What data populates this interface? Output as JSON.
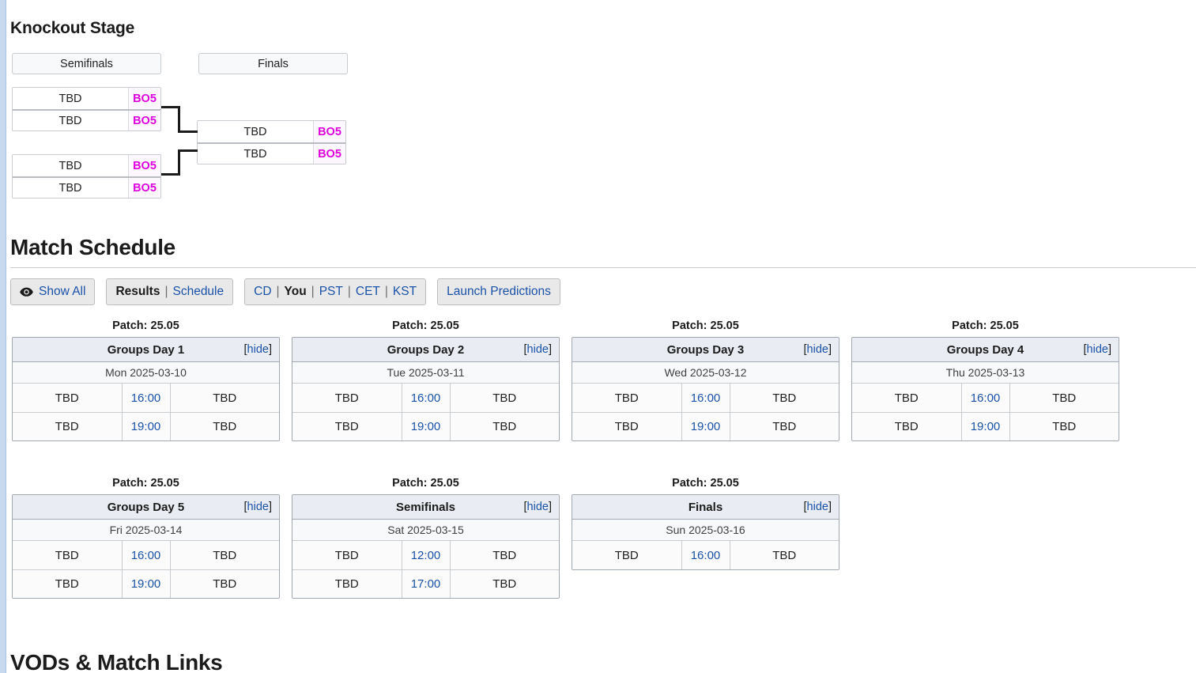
{
  "knockout": {
    "title": "Knockout Stage",
    "rounds": [
      {
        "label": "Semifinals"
      },
      {
        "label": "Finals"
      }
    ],
    "matches": [
      {
        "top_team": "TBD",
        "top_format": "BO5",
        "bottom_team": "TBD",
        "bottom_format": "BO5"
      },
      {
        "top_team": "TBD",
        "top_format": "BO5",
        "bottom_team": "TBD",
        "bottom_format": "BO5"
      },
      {
        "top_team": "TBD",
        "top_format": "BO5",
        "bottom_team": "TBD",
        "bottom_format": "BO5"
      }
    ]
  },
  "schedule": {
    "title": "Match Schedule",
    "toolbar": {
      "show_all": {
        "icon": "eye-icon",
        "label": "Show All"
      },
      "view": {
        "results": "Results",
        "separator": "|",
        "schedule": "Schedule"
      },
      "timezones": {
        "cd": "CD",
        "you": "You",
        "pst": "PST",
        "cet": "CET",
        "kst": "KST",
        "separator": "|"
      },
      "predictions": "Launch Predictions"
    },
    "cards": [
      {
        "patch": "Patch: 25.05",
        "title": "Groups Day 1",
        "hide": "hide",
        "date": "Mon 2025-03-10",
        "matches": [
          {
            "left": "TBD",
            "time": "16:00",
            "right": "TBD"
          },
          {
            "left": "TBD",
            "time": "19:00",
            "right": "TBD"
          }
        ]
      },
      {
        "patch": "Patch: 25.05",
        "title": "Groups Day 2",
        "hide": "hide",
        "date": "Tue 2025-03-11",
        "matches": [
          {
            "left": "TBD",
            "time": "16:00",
            "right": "TBD"
          },
          {
            "left": "TBD",
            "time": "19:00",
            "right": "TBD"
          }
        ]
      },
      {
        "patch": "Patch: 25.05",
        "title": "Groups Day 3",
        "hide": "hide",
        "date": "Wed 2025-03-12",
        "matches": [
          {
            "left": "TBD",
            "time": "16:00",
            "right": "TBD"
          },
          {
            "left": "TBD",
            "time": "19:00",
            "right": "TBD"
          }
        ]
      },
      {
        "patch": "Patch: 25.05",
        "title": "Groups Day 4",
        "hide": "hide",
        "date": "Thu 2025-03-13",
        "matches": [
          {
            "left": "TBD",
            "time": "16:00",
            "right": "TBD"
          },
          {
            "left": "TBD",
            "time": "19:00",
            "right": "TBD"
          }
        ]
      },
      {
        "patch": "Patch: 25.05",
        "title": "Groups Day 5",
        "hide": "hide",
        "date": "Fri 2025-03-14",
        "matches": [
          {
            "left": "TBD",
            "time": "16:00",
            "right": "TBD"
          },
          {
            "left": "TBD",
            "time": "19:00",
            "right": "TBD"
          }
        ]
      },
      {
        "patch": "Patch: 25.05",
        "title": "Semifinals",
        "hide": "hide",
        "date": "Sat 2025-03-15",
        "matches": [
          {
            "left": "TBD",
            "time": "12:00",
            "right": "TBD"
          },
          {
            "left": "TBD",
            "time": "17:00",
            "right": "TBD"
          }
        ]
      },
      {
        "patch": "Patch: 25.05",
        "title": "Finals",
        "hide": "hide",
        "date": "Sun 2025-03-16",
        "matches": [
          {
            "left": "TBD",
            "time": "16:00",
            "right": "TBD"
          }
        ]
      }
    ]
  },
  "vods": {
    "title": "VODs & Match Links"
  },
  "colors": {
    "link": "#1a52a8",
    "format_badge": "#dd00dd",
    "card_header_bg": "#e9ecf2",
    "page_edge": "#c6d9ef"
  }
}
